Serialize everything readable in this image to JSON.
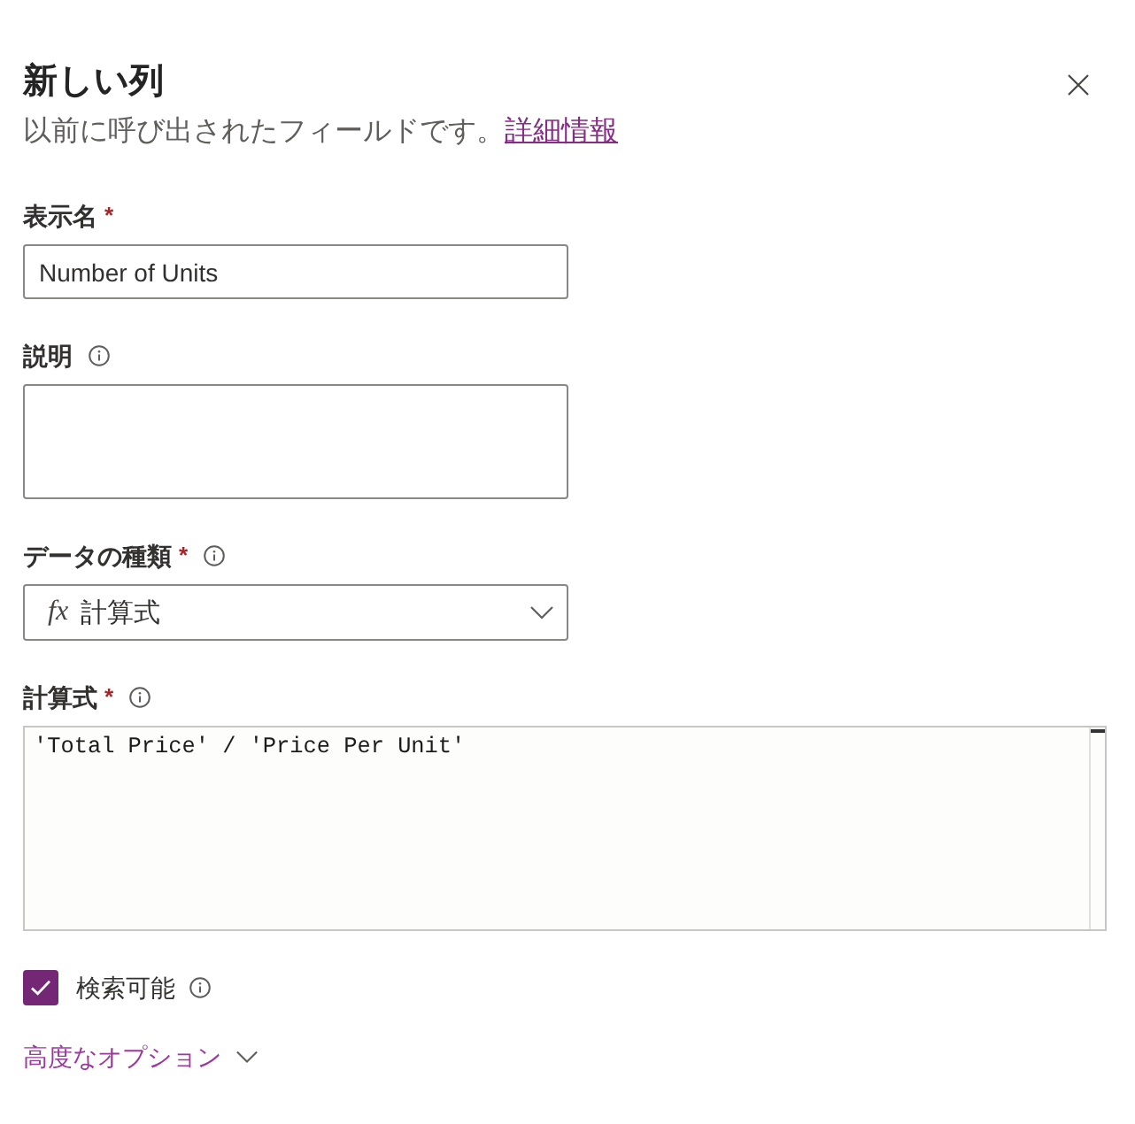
{
  "panel": {
    "title": "新しい列",
    "subtitle": "以前に呼び出されたフィールドです。",
    "link": "詳細情報"
  },
  "fields": [
    {
      "kind": "text",
      "label": "表示名",
      "required_mark": "*",
      "value": "Number of Units"
    },
    {
      "kind": "textarea",
      "label": "説明",
      "info": true
    },
    {
      "kind": "select",
      "label": "データの種類",
      "required_mark": "*",
      "info": true,
      "icon": "fx",
      "value": "計算式"
    },
    {
      "kind": "formula",
      "label": "計算式",
      "required_mark": "*",
      "info": true,
      "value": "'Total Price' / 'Price Per Unit'"
    }
  ],
  "checkbox": {
    "label": "検索可能",
    "checked": true,
    "info": true
  },
  "advanced": {
    "label": "高度なオプション",
    "expanded": false
  }
}
